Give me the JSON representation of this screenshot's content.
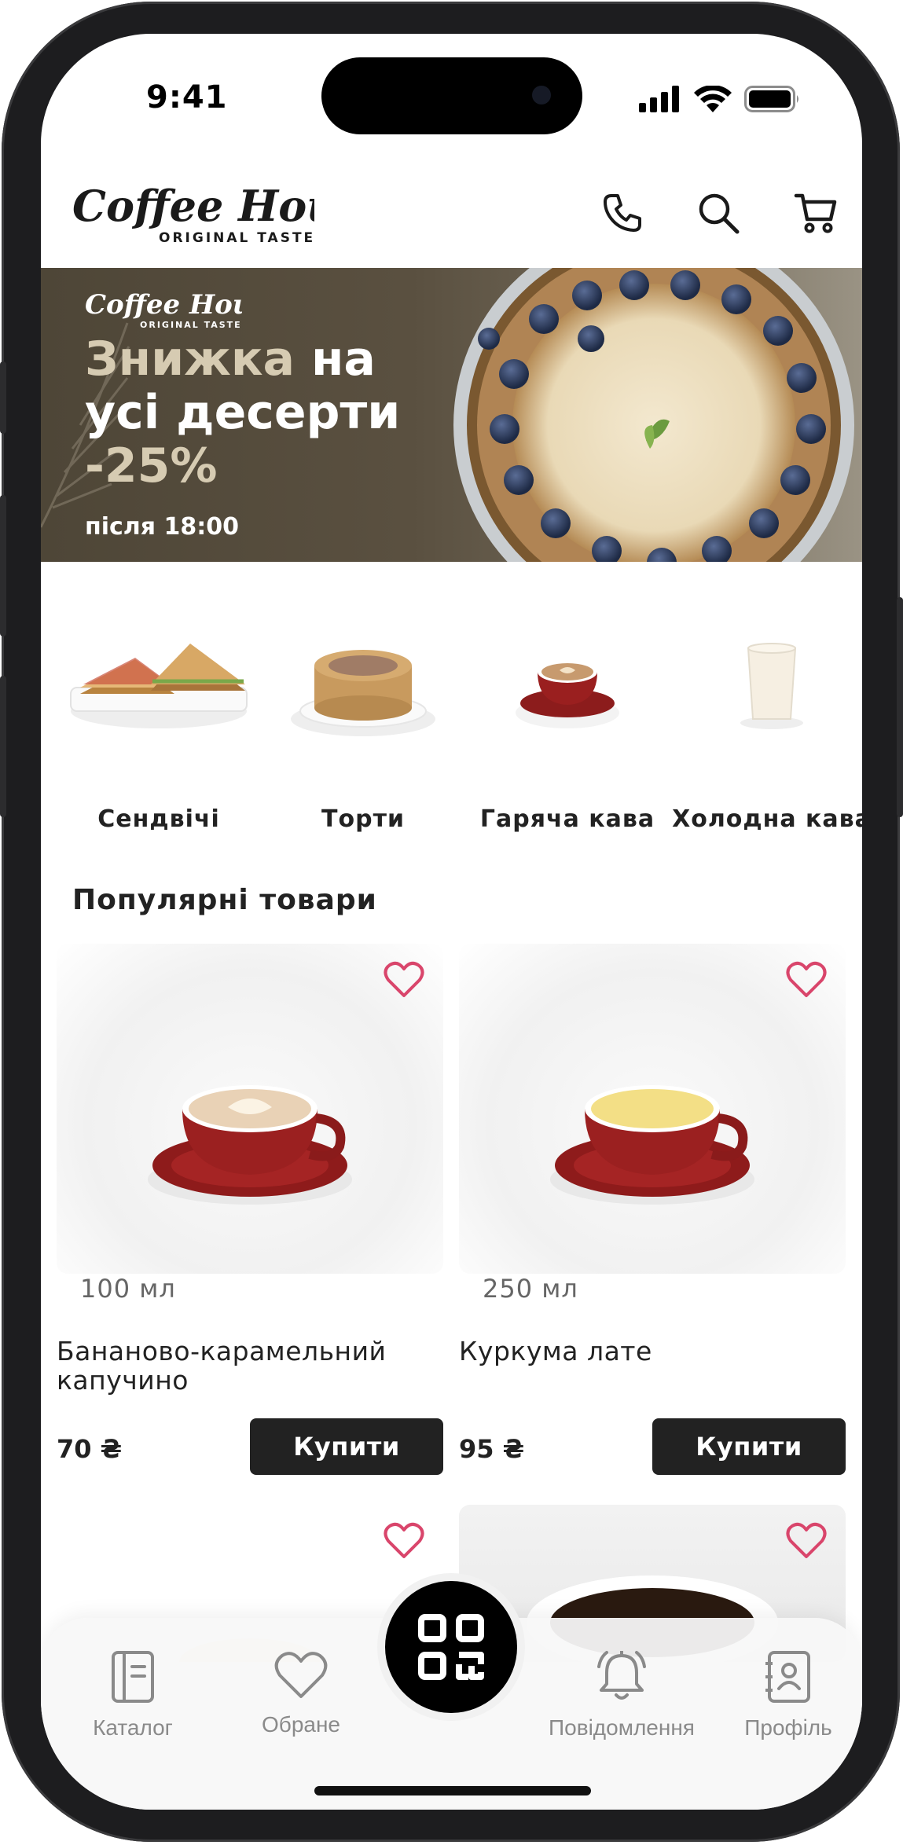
{
  "status_bar": {
    "time": "9:41"
  },
  "header": {
    "logo_main": "Coffee House",
    "logo_sub": "ORIGINAL TASTE"
  },
  "banner": {
    "logo_main": "Coffee House",
    "logo_sub": "ORIGINAL TASTE",
    "title_accent": "Знижка",
    "title_rest_1": "на",
    "title_line_2": "усі десерти",
    "discount": "-25%",
    "time_note": "після 18:00"
  },
  "categories": [
    {
      "label": "Сендвічі"
    },
    {
      "label": "Торти"
    },
    {
      "label": "Гаряча кава"
    },
    {
      "label": "Холодна кава"
    }
  ],
  "popular": {
    "title": "Популярні товари",
    "products": [
      {
        "volume": "100 мл",
        "name": "Бананово-карамельний капучино",
        "price": "70 ₴",
        "buy_label": "Купити"
      },
      {
        "volume": "250 мл",
        "name": "Куркума лате",
        "price": "95 ₴",
        "buy_label": "Купити"
      }
    ]
  },
  "bottom_nav": {
    "catalog": "Каталог",
    "favorites": "Обране",
    "notifications": "Повідомлення",
    "profile": "Профіль"
  },
  "colors": {
    "accent_heart": "#d9456b",
    "button_dark": "#222222",
    "banner_bg": "#4e4637",
    "banner_accent": "#d6cbb2"
  }
}
